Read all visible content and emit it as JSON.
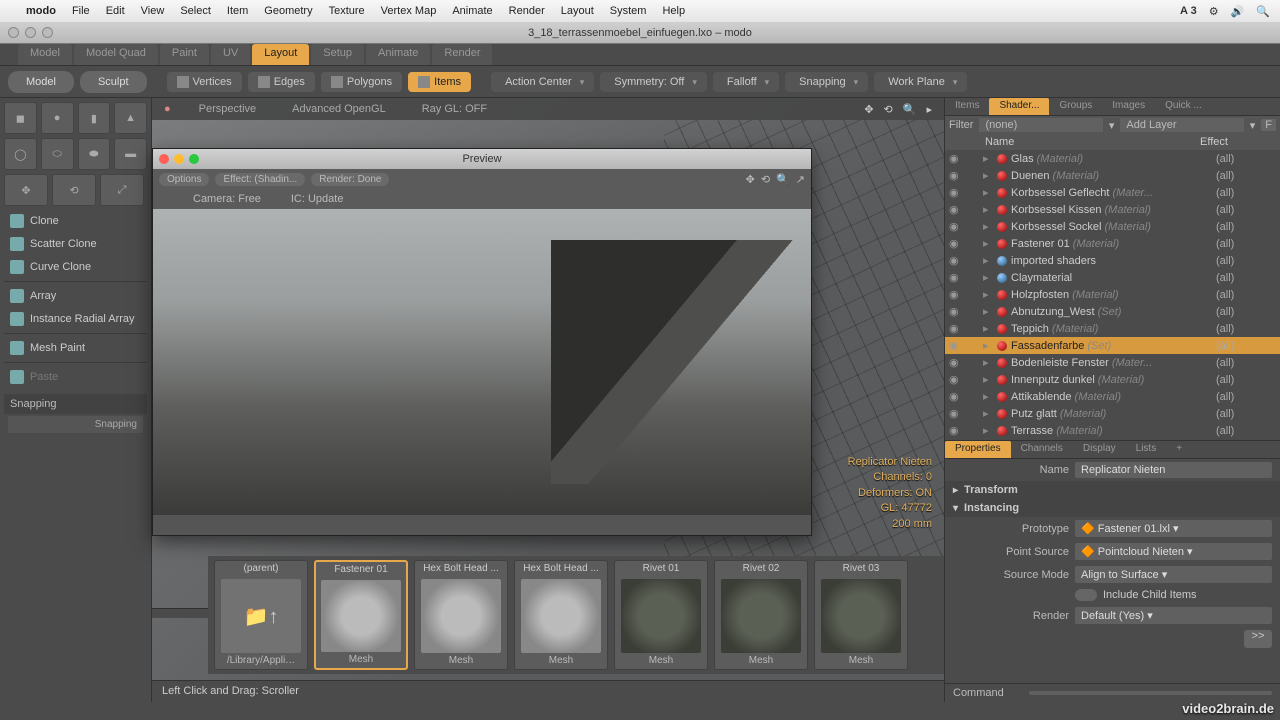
{
  "mac": {
    "menu": [
      "modo",
      "File",
      "Edit",
      "View",
      "Select",
      "Item",
      "Geometry",
      "Texture",
      "Vertex Map",
      "Animate",
      "Render",
      "Layout",
      "System",
      "Help"
    ],
    "status_a3": "A 3"
  },
  "window": {
    "title": "3_18_terrassenmoebel_einfuegen.lxo – modo"
  },
  "layout_tabs": [
    "Model",
    "Model Quad",
    "Paint",
    "UV",
    "Layout",
    "Setup",
    "Animate",
    "Render"
  ],
  "layout_active": 4,
  "modes": {
    "model": "Model",
    "sculpt": "Sculpt"
  },
  "components": [
    {
      "label": "Vertices",
      "active": false
    },
    {
      "label": "Edges",
      "active": false
    },
    {
      "label": "Polygons",
      "active": false
    },
    {
      "label": "Items",
      "active": true
    }
  ],
  "top_drops": {
    "action_center": "Action Center",
    "symmetry": "Symmetry: Off",
    "falloff": "Falloff",
    "snapping": "Snapping",
    "workplane": "Work Plane"
  },
  "left": {
    "tools": [
      "Clone",
      "Scatter Clone",
      "Curve Clone",
      "Array",
      "Instance Radial Array",
      "Mesh Paint",
      "Paste"
    ],
    "section": "Snapping",
    "sub": "Snapping"
  },
  "viewport": {
    "tabs": [
      "Perspective",
      "Advanced OpenGL",
      "Ray GL: OFF"
    ],
    "hud_name": "Replicator Nieten",
    "hud_channels": "Channels: 0",
    "hud_deformers": "Deformers: ON",
    "hud_gl": "GL: 47772",
    "hud_scale": "200 mm"
  },
  "preview": {
    "title": "Preview",
    "options": "Options",
    "effect": "Effect: (Shadin...",
    "render": "Render: Done",
    "camera": "Camera: Free",
    "ic": "IC: Update"
  },
  "assets": [
    {
      "name": "(parent)",
      "type": "/Library/Appli…",
      "kind": "folder"
    },
    {
      "name": "Fastener 01",
      "type": "Mesh",
      "kind": "light",
      "sel": true
    },
    {
      "name": "Hex Bolt Head ...",
      "type": "Mesh",
      "kind": "light"
    },
    {
      "name": "Hex Bolt Head ...",
      "type": "Mesh",
      "kind": "light"
    },
    {
      "name": "Rivet 01",
      "type": "Mesh",
      "kind": "dark"
    },
    {
      "name": "Rivet 02",
      "type": "Mesh",
      "kind": "dark"
    },
    {
      "name": "Rivet 03",
      "type": "Mesh",
      "kind": "dark"
    }
  ],
  "statusbar": "Left Click and Drag:   Scroller",
  "right": {
    "tabs": [
      "Items",
      "Shader...",
      "Groups",
      "Images",
      "Quick ..."
    ],
    "active": 1,
    "filter_label": "Filter",
    "filter_value": "(none)",
    "addlayer": "Add Layer",
    "head_name": "Name",
    "head_effect": "Effect",
    "rows": [
      {
        "n": "Glas",
        "s": "(Material)",
        "e": "(all)"
      },
      {
        "n": "Duenen",
        "s": "(Material)",
        "e": "(all)"
      },
      {
        "n": "Korbsessel Geflecht",
        "s": "(Mater...",
        "e": "(all)"
      },
      {
        "n": "Korbsessel Kissen",
        "s": "(Material)",
        "e": "(all)"
      },
      {
        "n": "Korbsessel Sockel",
        "s": "(Material)",
        "e": "(all)"
      },
      {
        "n": "Fastener 01",
        "s": "(Material)",
        "e": "(all)"
      },
      {
        "n": "imported shaders",
        "s": "",
        "e": "(all)",
        "g": true
      },
      {
        "n": "Claymaterial",
        "s": "",
        "e": "(all)",
        "g": true
      },
      {
        "n": "Holzpfosten",
        "s": "(Material)",
        "e": "(all)"
      },
      {
        "n": "Abnutzung_West",
        "s": "(Set)",
        "e": "(all)"
      },
      {
        "n": "Teppich",
        "s": "(Material)",
        "e": "(all)"
      },
      {
        "n": "Fassadenfarbe",
        "s": "(Set)",
        "e": "(all)",
        "sel": true
      },
      {
        "n": "Bodenleiste Fenster",
        "s": "(Mater...",
        "e": "(all)"
      },
      {
        "n": "Innenputz dunkel",
        "s": "(Material)",
        "e": "(all)"
      },
      {
        "n": "Attikablende",
        "s": "(Material)",
        "e": "(all)"
      },
      {
        "n": "Putz glatt",
        "s": "(Material)",
        "e": "(all)"
      },
      {
        "n": "Terrasse",
        "s": "(Material)",
        "e": "(all)"
      }
    ],
    "props_tabs": [
      "Properties",
      "Channels",
      "Display",
      "Lists"
    ],
    "props_active": 0,
    "name_label": "Name",
    "name_value": "Replicator Nieten",
    "transform": "Transform",
    "instancing": "Instancing",
    "prototype_l": "Prototype",
    "prototype_v": "Fastener 01.lxl",
    "pointsrc_l": "Point Source",
    "pointsrc_v": "Pointcloud Nieten",
    "srcmode_l": "Source Mode",
    "srcmode_v": "Align to Surface",
    "child": "Include Child Items",
    "render_l": "Render",
    "render_v": "Default (Yes)",
    "go": ">>"
  },
  "watermark": "video2brain.de",
  "command_l": "Command"
}
